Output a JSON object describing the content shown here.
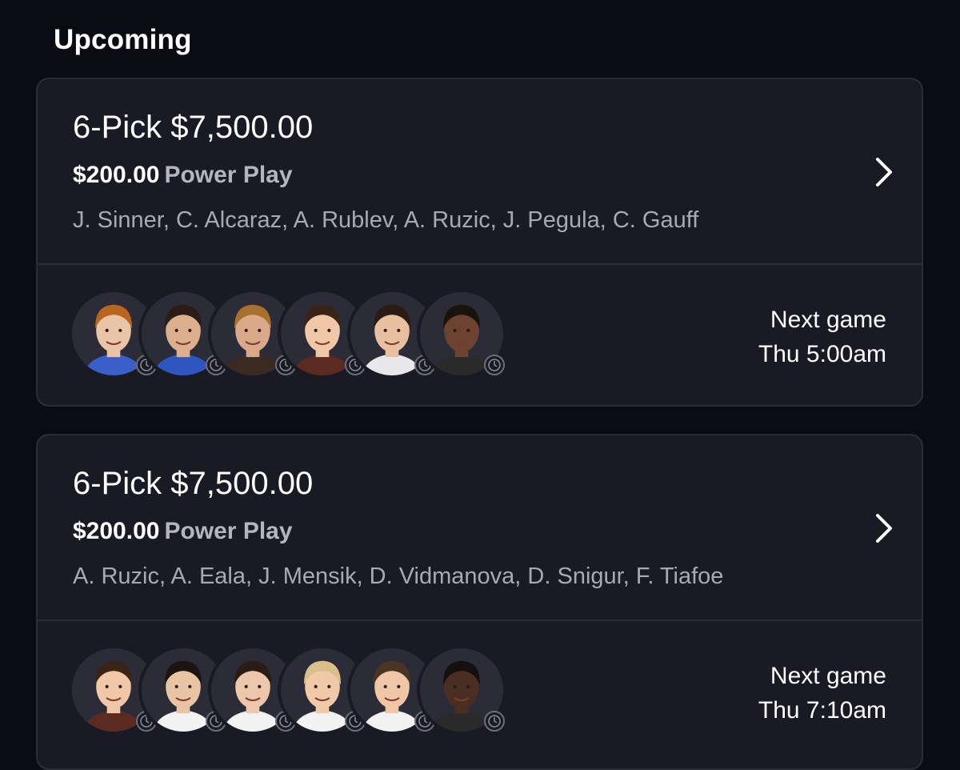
{
  "section": {
    "title": "Upcoming"
  },
  "entries": [
    {
      "title": "6-Pick $7,500.00",
      "entry_amount": "$200.00",
      "mode": "Power Play",
      "players": "J. Sinner, C. Alcaraz, A. Rublev, A. Ruzic, J. Pegula, C. Gauff",
      "next_game_label": "Next game",
      "next_game_time": "Thu 5:00am",
      "avatar_skin": [
        "#e9c4a6",
        "#dcb08c",
        "#d9a98a",
        "#f0c8a8",
        "#e8c0a0",
        "#6b4330"
      ],
      "avatar_hair": [
        "#b8651f",
        "#2b1d15",
        "#a8702f",
        "#3a2418",
        "#2a1c14",
        "#1a120c"
      ],
      "avatar_shirt": [
        "#3a5fc8",
        "#2f55c0",
        "#3a2a22",
        "#5b2a20",
        "#e8e8ea",
        "#2a2a2a"
      ]
    },
    {
      "title": "6-Pick $7,500.00",
      "entry_amount": "$200.00",
      "mode": "Power Play",
      "players": "A. Ruzic, A. Eala, J. Mensik, D. Vidmanova, D. Snigur, F. Tiafoe",
      "next_game_label": "Next game",
      "next_game_time": "Thu 7:10am",
      "avatar_skin": [
        "#f0c8a8",
        "#e8c4a4",
        "#ecc7ab",
        "#f0c9a8",
        "#efc6a6",
        "#4a2e22"
      ],
      "avatar_hair": [
        "#3a2418",
        "#1b140f",
        "#2a1d16",
        "#d9bf8a",
        "#4a3424",
        "#151010"
      ],
      "avatar_shirt": [
        "#5b2a20",
        "#f2f2f2",
        "#f2f2f2",
        "#f2f2f2",
        "#f2f2f2",
        "#2a2a2a"
      ]
    }
  ],
  "colors": {
    "background": "#0b0b14",
    "card": "#1a1a24",
    "muted_text": "#a9a9b6",
    "mode_text": "#b5b5c2"
  },
  "icons": {
    "chevron": "chevron-right-icon",
    "clock": "clock-icon"
  }
}
